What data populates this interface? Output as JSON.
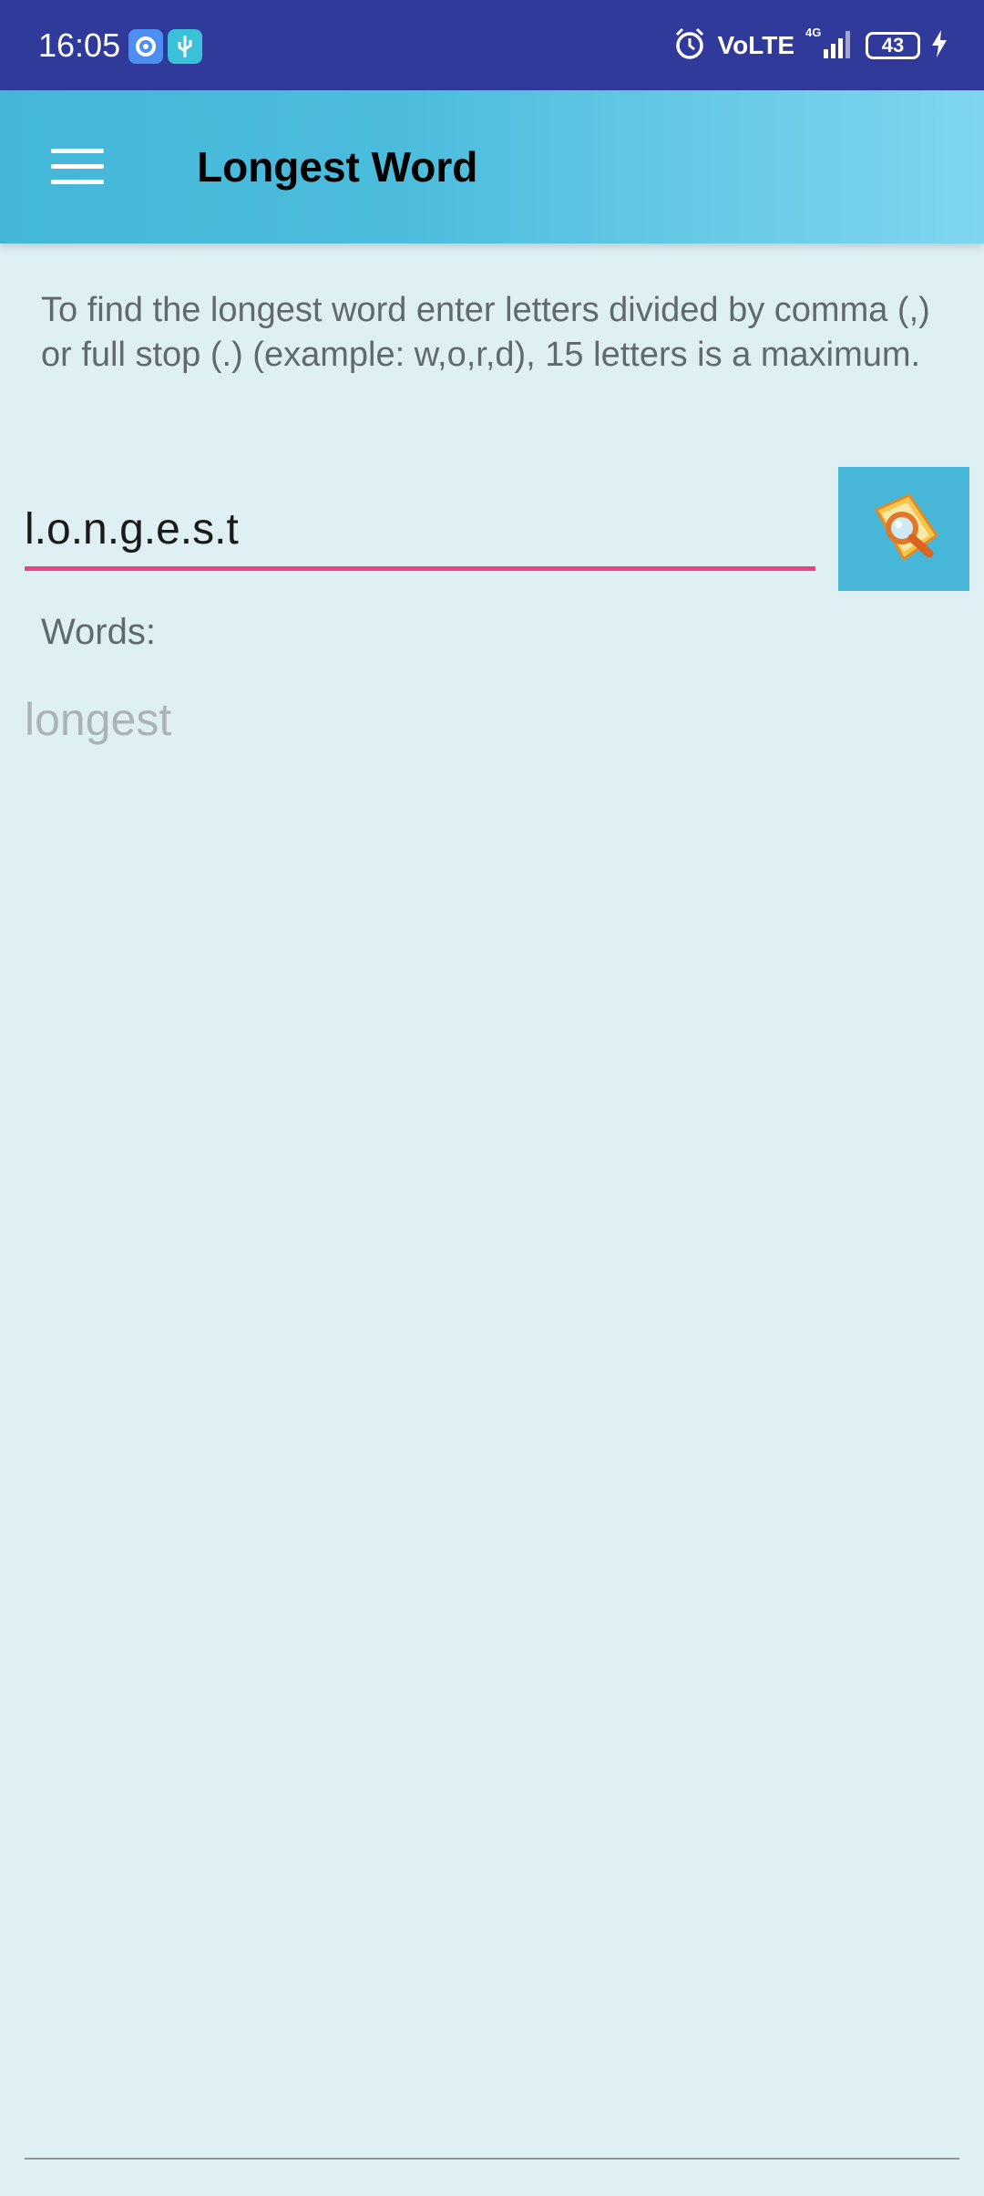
{
  "status_bar": {
    "time": "16:05",
    "icons": [
      "settings-app-icon",
      "usb-icon",
      "alarm-icon",
      "signal-icon",
      "charging-icon"
    ],
    "volte": "VoLTE",
    "network": "4G",
    "battery": "43"
  },
  "app_bar": {
    "title": "Longest Word",
    "menu_icon": "hamburger-menu-icon"
  },
  "main": {
    "instructions": "To find the longest word enter letters divided by comma (,) or full stop (.) (example: w,o,r,d), 15 letters is a maximum.",
    "letters_input_value": "l.o.n.g.e.s.t",
    "search_icon": "search-icon",
    "words_label": "Words:",
    "result": "longest"
  },
  "colors": {
    "status_bar": "#2f3a9b",
    "app_bar": "#44b7d9",
    "background": "#dff0f4",
    "input_underline": "#e64585"
  }
}
